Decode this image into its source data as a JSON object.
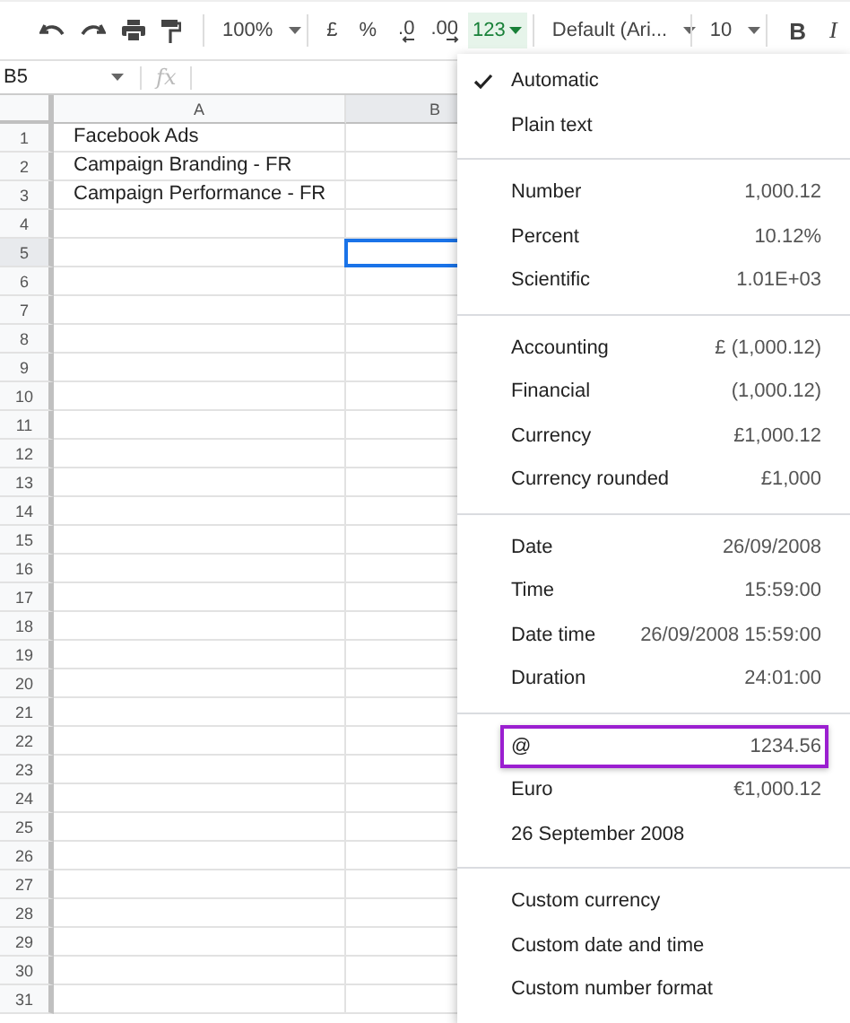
{
  "toolbar": {
    "zoom": "100%",
    "currency": "£",
    "percent": "%",
    "decrease_decimal": ".0",
    "increase_decimal": ".00",
    "format_button": {
      "label": "123",
      "active": true
    },
    "font": "Default (Ari...",
    "font_size": "10",
    "bold": "B",
    "italic": "I"
  },
  "formula_bar": {
    "name_box": "B5",
    "function_label": "fx"
  },
  "columns": [
    {
      "label": "A",
      "selected": false
    },
    {
      "label": "B",
      "selected": true
    }
  ],
  "rows": [
    {
      "number": "1",
      "selected": false,
      "cell_a": "Facebook Ads"
    },
    {
      "number": "2",
      "selected": false,
      "cell_a": "Campaign Branding - FR"
    },
    {
      "number": "3",
      "selected": false,
      "cell_a": "Campaign Performance - FR"
    },
    {
      "number": "4",
      "selected": false
    },
    {
      "number": "5",
      "selected": true
    },
    {
      "number": "6",
      "selected": false
    },
    {
      "number": "7",
      "selected": false
    },
    {
      "number": "8",
      "selected": false
    },
    {
      "number": "9",
      "selected": false
    },
    {
      "number": "10",
      "selected": false
    },
    {
      "number": "11",
      "selected": false
    },
    {
      "number": "12",
      "selected": false
    },
    {
      "number": "13",
      "selected": false
    },
    {
      "number": "14",
      "selected": false
    },
    {
      "number": "15",
      "selected": false
    },
    {
      "number": "16",
      "selected": false
    },
    {
      "number": "17",
      "selected": false
    },
    {
      "number": "18",
      "selected": false
    },
    {
      "number": "19",
      "selected": false
    },
    {
      "number": "20",
      "selected": false
    },
    {
      "number": "21",
      "selected": false
    },
    {
      "number": "22",
      "selected": false
    },
    {
      "number": "23",
      "selected": false
    },
    {
      "number": "24",
      "selected": false
    },
    {
      "number": "25",
      "selected": false
    },
    {
      "number": "26",
      "selected": false
    },
    {
      "number": "27",
      "selected": false
    },
    {
      "number": "28",
      "selected": false
    },
    {
      "number": "29",
      "selected": false
    },
    {
      "number": "30",
      "selected": false
    },
    {
      "number": "31",
      "selected": false
    }
  ],
  "menu": {
    "sections": [
      {
        "items": [
          {
            "label": "Automatic",
            "checked": true,
            "highlighted": false
          },
          {
            "label": "Plain text",
            "checked": false,
            "highlighted": false
          }
        ]
      },
      {
        "items": [
          {
            "label": "Number",
            "example": "1,000.12",
            "checked": false,
            "highlighted": false
          },
          {
            "label": "Percent",
            "example": "10.12%",
            "checked": false,
            "highlighted": false
          },
          {
            "label": "Scientific",
            "example": "1.01E+03",
            "checked": false,
            "highlighted": false
          }
        ]
      },
      {
        "items": [
          {
            "label": "Accounting",
            "example": "£ (1,000.12)",
            "checked": false,
            "highlighted": false
          },
          {
            "label": "Financial",
            "example": "(1,000.12)",
            "checked": false,
            "highlighted": false
          },
          {
            "label": "Currency",
            "example": "£1,000.12",
            "checked": false,
            "highlighted": false
          },
          {
            "label": "Currency rounded",
            "example": "£1,000",
            "checked": false,
            "highlighted": false
          }
        ]
      },
      {
        "items": [
          {
            "label": "Date",
            "example": "26/09/2008",
            "checked": false,
            "highlighted": false
          },
          {
            "label": "Time",
            "example": "15:59:00",
            "checked": false,
            "highlighted": false
          },
          {
            "label": "Date time",
            "example": "26/09/2008 15:59:00",
            "checked": false,
            "highlighted": false
          },
          {
            "label": "Duration",
            "example": "24:01:00",
            "checked": false,
            "highlighted": false
          }
        ]
      },
      {
        "items": [
          {
            "label": "@",
            "example": "1234.56",
            "checked": false,
            "highlighted": true
          },
          {
            "label": "Euro",
            "example": "€1,000.12",
            "checked": false,
            "highlighted": false
          },
          {
            "label": "26 September 2008",
            "checked": false,
            "highlighted": false
          }
        ]
      },
      {
        "items": [
          {
            "label": "Custom currency",
            "checked": false,
            "highlighted": false
          },
          {
            "label": "Custom date and time",
            "checked": false,
            "highlighted": false
          },
          {
            "label": "Custom number format",
            "checked": false,
            "highlighted": false
          }
        ]
      }
    ]
  }
}
